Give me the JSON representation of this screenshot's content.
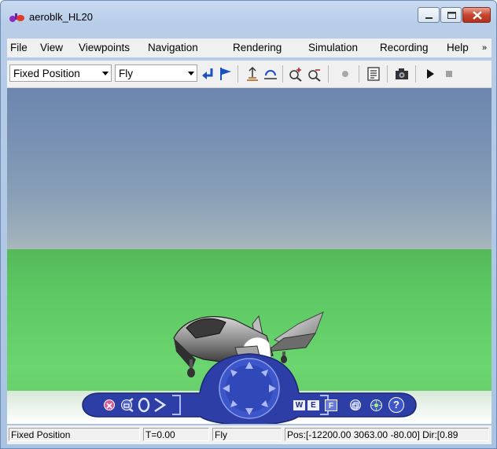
{
  "window": {
    "title": "aeroblk_HL20"
  },
  "menu": {
    "items": [
      "File",
      "View",
      "Viewpoints",
      "Navigation",
      "Rendering",
      "Simulation",
      "Recording",
      "Help"
    ],
    "overflow_glyph": "»"
  },
  "toolbar": {
    "viewpoint": "Fixed Position",
    "nav_mode": "Fly"
  },
  "nav_panel": {
    "walk": "W",
    "examine": "E",
    "fly": "F",
    "help": "?"
  },
  "status": {
    "viewpoint": "Fixed Position",
    "time": "T=0.00",
    "mode": "Fly",
    "position": "Pos:[-12200.00 3063.00 -80.00] Dir:[0.89"
  },
  "colors": {
    "sky_top": "#6d86ad",
    "ground": "#5ec964",
    "nav_panel": "#2d3fa6"
  }
}
